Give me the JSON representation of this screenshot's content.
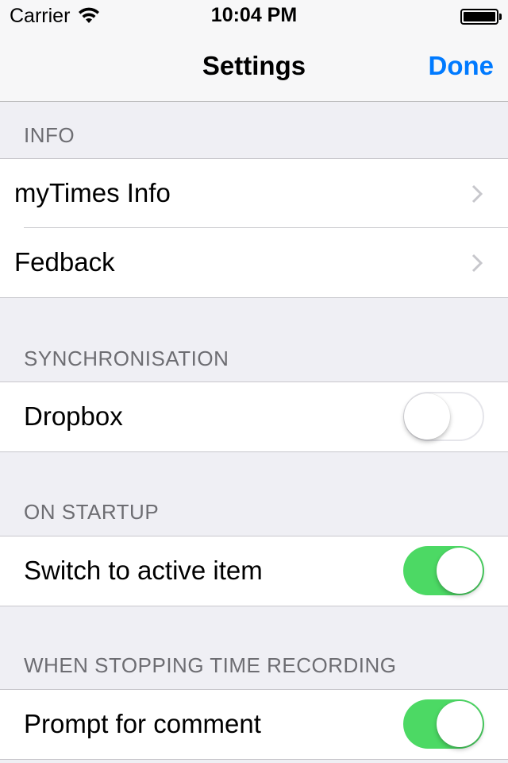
{
  "status_bar": {
    "carrier": "Carrier",
    "time": "10:04 PM",
    "wifi_icon": "wifi-icon",
    "battery_icon": "battery-icon"
  },
  "nav": {
    "title": "Settings",
    "done_label": "Done"
  },
  "colors": {
    "accent": "#007aff",
    "switch_on": "#4cd964",
    "background": "#efeff4"
  },
  "sections": {
    "info": {
      "header": "INFO",
      "items": [
        {
          "label": "myTimes Info",
          "accessory": "chevron-right-icon"
        },
        {
          "label": "Fedback",
          "accessory": "chevron-right-icon"
        }
      ]
    },
    "sync": {
      "header": "SYNCHRONISATION",
      "items": [
        {
          "label": "Dropbox",
          "switch_on": false
        }
      ]
    },
    "startup": {
      "header": "ON STARTUP",
      "items": [
        {
          "label": "Switch to active item",
          "switch_on": true
        }
      ]
    },
    "stopping": {
      "header": "WHEN STOPPING TIME RECORDING",
      "items": [
        {
          "label": "Prompt for comment",
          "switch_on": true
        }
      ]
    }
  }
}
